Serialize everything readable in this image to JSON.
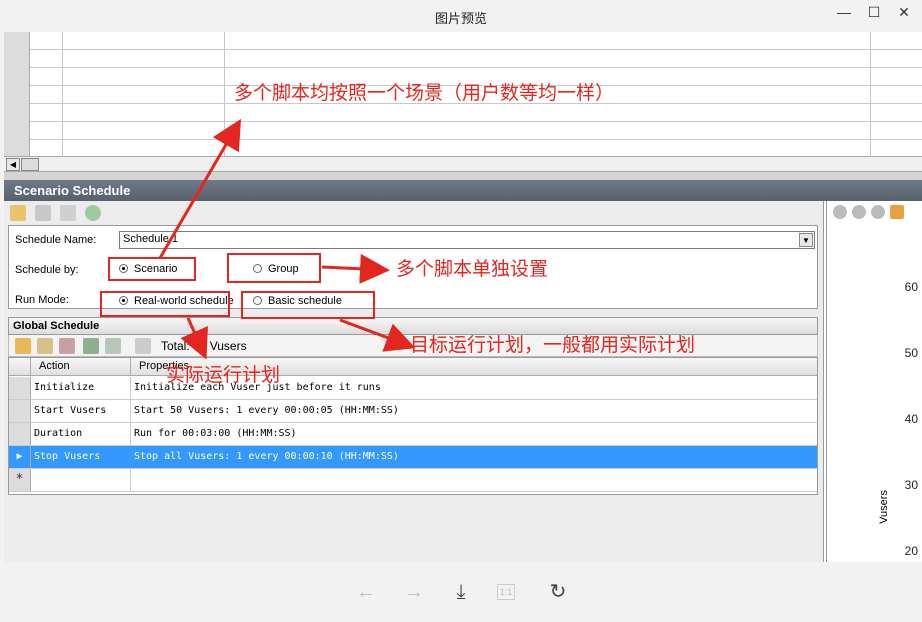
{
  "viewer": {
    "title": "图片预览",
    "controls": {
      "minimize": "—",
      "maximize": "☐",
      "close": "✕"
    },
    "bottom": {
      "prev": "←",
      "next": "→",
      "download": "⤓",
      "actual_size": "1:1",
      "rotate": "↻"
    }
  },
  "section_header": "Scenario Schedule",
  "form": {
    "schedule_name_label": "Schedule Name:",
    "schedule_name_value": "Schedule 1",
    "schedule_by_label": "Schedule by:",
    "schedule_by_options": [
      "Scenario",
      "Group"
    ],
    "schedule_by_selected": "Scenario",
    "run_mode_label": "Run Mode:",
    "run_mode_options": [
      "Real-world schedule",
      "Basic schedule"
    ],
    "run_mode_selected": "Real-world schedule"
  },
  "global_schedule": {
    "title": "Global Schedule",
    "total": "Total: 50 Vusers",
    "columns": [
      "Action",
      "Properties"
    ],
    "rows": [
      {
        "action": "Initialize",
        "properties": "Initialize each Vuser just before it runs"
      },
      {
        "action": "Start  Vusers",
        "properties": "Start 50 Vusers: 1 every 00:00:05 (HH:MM:SS)"
      },
      {
        "action": "Duration",
        "properties": "Run for 00:03:00 (HH:MM:SS)"
      },
      {
        "action": "Stop Vusers",
        "properties": "Stop all Vusers: 1 every 00:00:10 (HH:MM:SS)"
      }
    ],
    "new_row_marker": "*",
    "selected_row": 3
  },
  "chart": {
    "ylabel": "Vusers",
    "yticks": [
      "60",
      "50",
      "40",
      "30",
      "20"
    ]
  },
  "annotations": {
    "note1": "多个脚本均按照一个场景（用户数等均一样）",
    "note2": "多个脚本单独设置",
    "note3": "目标运行计划，一般都用实际计划",
    "note4": "实际运行计划"
  },
  "colors": {
    "annotation": "#e3261f",
    "selection": "#3399ff",
    "section_header": "#56616c"
  }
}
